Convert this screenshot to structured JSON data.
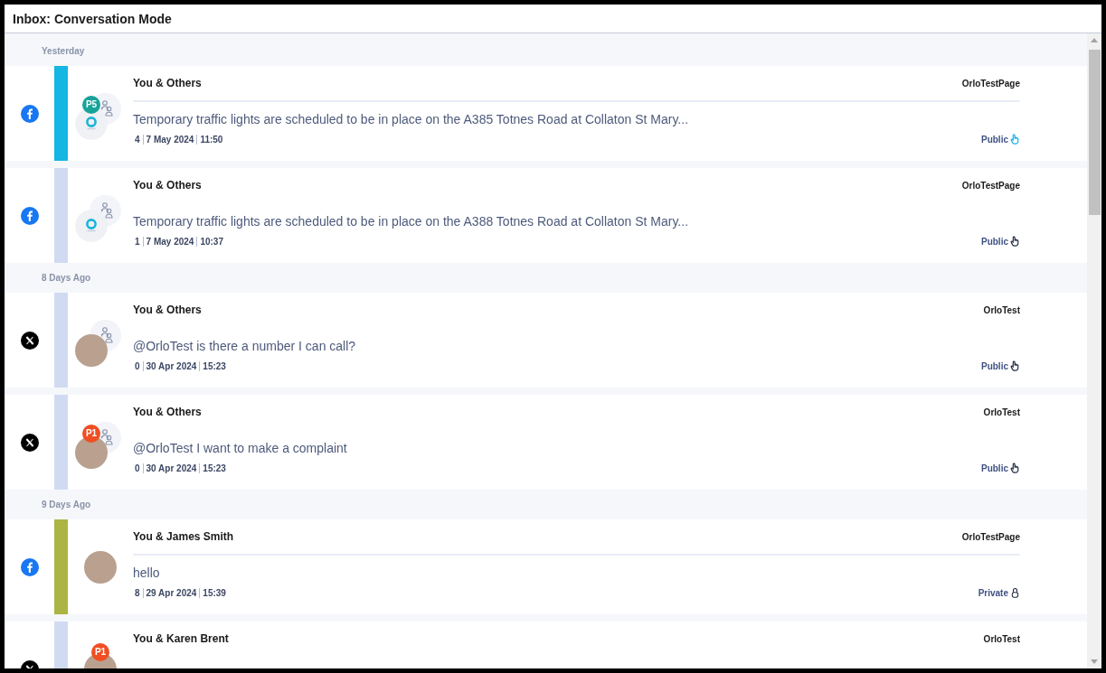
{
  "window": {
    "title": "Inbox: Conversation Mode"
  },
  "groups": [
    {
      "label": "Yesterday",
      "conversations": [
        {
          "kind": "facebook",
          "color": "#14b6e3",
          "avatar": {
            "kind": "group-logo",
            "badge": {
              "label": "P5",
              "color": "#17a398"
            }
          },
          "title": "You & Others",
          "account": "OrloTestPage",
          "divider": true,
          "message": "Temporary traffic lights are scheduled to be in place on the A385 Totnes Road at Collaton St Mary...",
          "reply_count": "4",
          "date": "7 May 2024",
          "time": "11:50",
          "visibility": {
            "kind": "public",
            "label": "Public",
            "highlighted": true
          }
        },
        {
          "kind": "facebook",
          "color": "#d0dbf2",
          "avatar": {
            "kind": "group-logo"
          },
          "title": "You & Others",
          "account": "OrloTestPage",
          "divider": false,
          "message": "Temporary traffic lights are scheduled to be in place on the A388 Totnes Road at Collaton St Mary...",
          "reply_count": "1",
          "date": "7 May 2024",
          "time": "10:37",
          "visibility": {
            "kind": "public",
            "label": "Public",
            "highlighted": false
          }
        }
      ]
    },
    {
      "label": "8 Days Ago",
      "conversations": [
        {
          "kind": "x",
          "color": "#d0dbf2",
          "avatar": {
            "kind": "group-photo"
          },
          "title": "You & Others",
          "account": "OrloTest",
          "divider": false,
          "message": "@OrloTest is there a number I can call?",
          "reply_count": "0",
          "date": "30 Apr 2024",
          "time": "15:23",
          "visibility": {
            "kind": "public",
            "label": "Public",
            "highlighted": false
          }
        },
        {
          "kind": "x",
          "color": "#d0dbf2",
          "avatar": {
            "kind": "group-photo",
            "badge": {
              "label": "P1",
              "color": "#f04e23"
            }
          },
          "title": "You & Others",
          "account": "OrloTest",
          "divider": false,
          "message": "@OrloTest I want to make a complaint",
          "reply_count": "0",
          "date": "30 Apr 2024",
          "time": "15:23",
          "visibility": {
            "kind": "public",
            "label": "Public",
            "highlighted": false
          }
        }
      ]
    },
    {
      "label": "9 Days Ago",
      "conversations": [
        {
          "kind": "facebook",
          "color": "#acb443",
          "avatar": {
            "kind": "single-photo"
          },
          "title": "You & James Smith",
          "account": "OrloTestPage",
          "divider": true,
          "message": "hello",
          "reply_count": "8",
          "date": "29 Apr 2024",
          "time": "15:39",
          "visibility": {
            "kind": "private",
            "label": "Private",
            "highlighted": false
          }
        },
        {
          "kind": "x",
          "color": "#d0dbf2",
          "avatar": {
            "kind": "single-photo",
            "badge": {
              "label": "P1",
              "color": "#f04e23"
            }
          },
          "title": "You & Karen Brent",
          "account": "OrloTest",
          "divider": false
        }
      ]
    }
  ]
}
